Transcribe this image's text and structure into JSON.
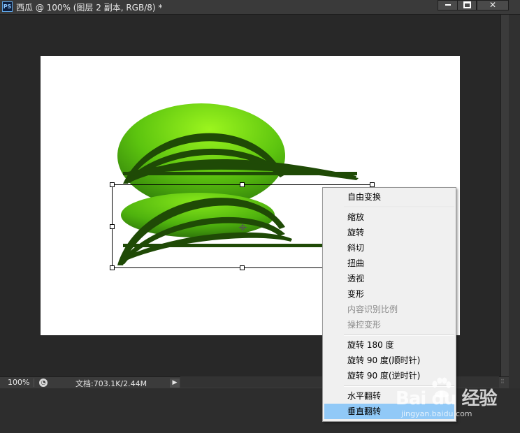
{
  "window": {
    "app_icon": "PS",
    "title": "西瓜 @ 100% (图层 2 副本, RGB/8) *",
    "controls": {
      "minimize": "minimize-icon",
      "maximize": "maximize-icon",
      "close": "close-icon"
    }
  },
  "status": {
    "zoom": "100%",
    "doc_info": "文档:703.1K/2.44M",
    "arrow": "▶"
  },
  "context_menu": {
    "items": [
      {
        "label": "自由变换",
        "disabled": false
      },
      {
        "label": "缩放",
        "disabled": false
      },
      {
        "label": "旋转",
        "disabled": false
      },
      {
        "label": "斜切",
        "disabled": false
      },
      {
        "label": "扭曲",
        "disabled": false
      },
      {
        "label": "透视",
        "disabled": false
      },
      {
        "label": "变形",
        "disabled": false
      },
      {
        "label": "内容识别比例",
        "disabled": true
      },
      {
        "label": "操控变形",
        "disabled": true
      },
      {
        "label": "旋转 180 度",
        "disabled": false
      },
      {
        "label": "旋转 90 度(顺时针)",
        "disabled": false
      },
      {
        "label": "旋转 90 度(逆时针)",
        "disabled": false
      },
      {
        "label": "水平翻转",
        "disabled": false
      },
      {
        "label": "垂直翻转",
        "disabled": false,
        "highlighted": true
      }
    ]
  },
  "watermark": {
    "logo": "Bai du 经验",
    "url": "jingyan.baidu.com"
  },
  "colors": {
    "melon_light": "#8ef01a",
    "melon_dark": "#1f4a06",
    "menu_highlight": "#91c9f7"
  }
}
